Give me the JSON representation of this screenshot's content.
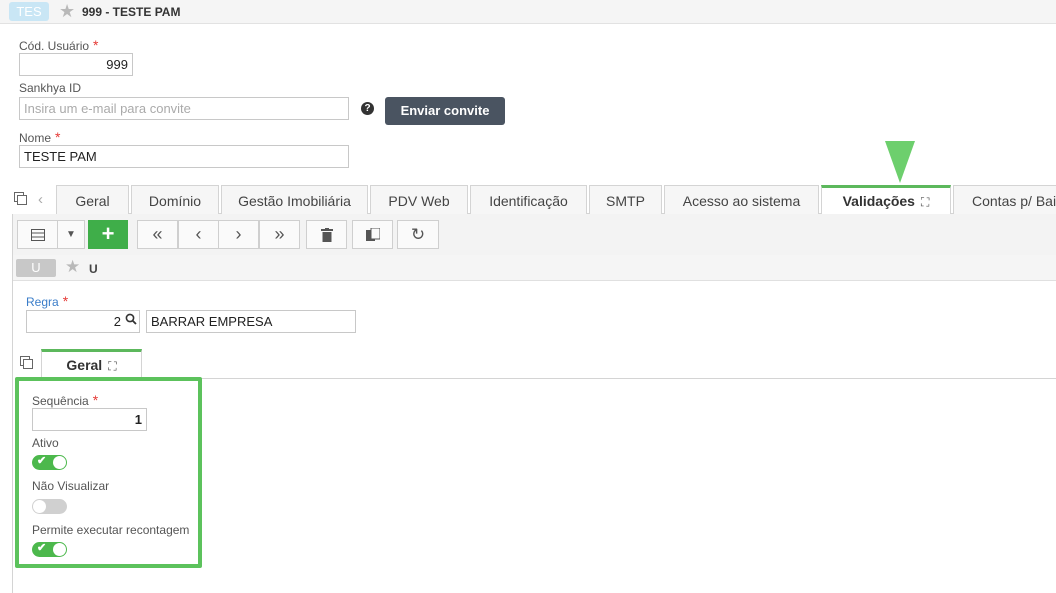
{
  "header": {
    "badge": "TES",
    "title": "999 - TESTE PAM"
  },
  "form": {
    "cod_usuario": {
      "label": "Cód. Usuário",
      "value": "999"
    },
    "sankhya_id": {
      "label": "Sankhya ID",
      "placeholder": "Insira um e-mail para convite"
    },
    "invite_button": "Enviar convite",
    "nome": {
      "label": "Nome",
      "value": "TESTE PAM"
    }
  },
  "tabs": [
    {
      "label": "Geral"
    },
    {
      "label": "Domínio"
    },
    {
      "label": "Gestão Imobiliária"
    },
    {
      "label": "PDV Web"
    },
    {
      "label": "Identificação"
    },
    {
      "label": "SMTP"
    },
    {
      "label": "Acesso ao sistema"
    },
    {
      "label": "Validações",
      "active": true
    },
    {
      "label": "Contas p/ Bai"
    }
  ],
  "sub_header": {
    "badge": "U",
    "title": "U"
  },
  "regra": {
    "label": "Regra",
    "code": "2",
    "description": "BARRAR EMPRESA"
  },
  "inner_tab": {
    "label": "Geral"
  },
  "fields": {
    "sequencia": {
      "label": "Sequência",
      "value": "1"
    },
    "ativo": {
      "label": "Ativo",
      "on": true
    },
    "nao_visualizar": {
      "label": "Não Visualizar",
      "on": false
    },
    "permite_recontagem": {
      "label": "Permite executar recontagem",
      "on": true
    }
  },
  "icons": [
    "star-icon",
    "help-icon",
    "copy-icon",
    "chevron-left-icon",
    "expand-icon",
    "grid-view-icon",
    "dropdown-icon",
    "add-icon",
    "first-icon",
    "prev-icon",
    "next-icon",
    "last-icon",
    "delete-icon",
    "duplicate-icon",
    "refresh-icon",
    "search-icon",
    "check-icon"
  ],
  "colors": {
    "accent_green": "#5cb85c",
    "add_button": "#3fae49",
    "dark_button": "#4a5461",
    "highlight": "#5cc25c",
    "arrow": "#6dcf6d",
    "link_blue": "#3a7dc9",
    "required": "#e53935"
  }
}
